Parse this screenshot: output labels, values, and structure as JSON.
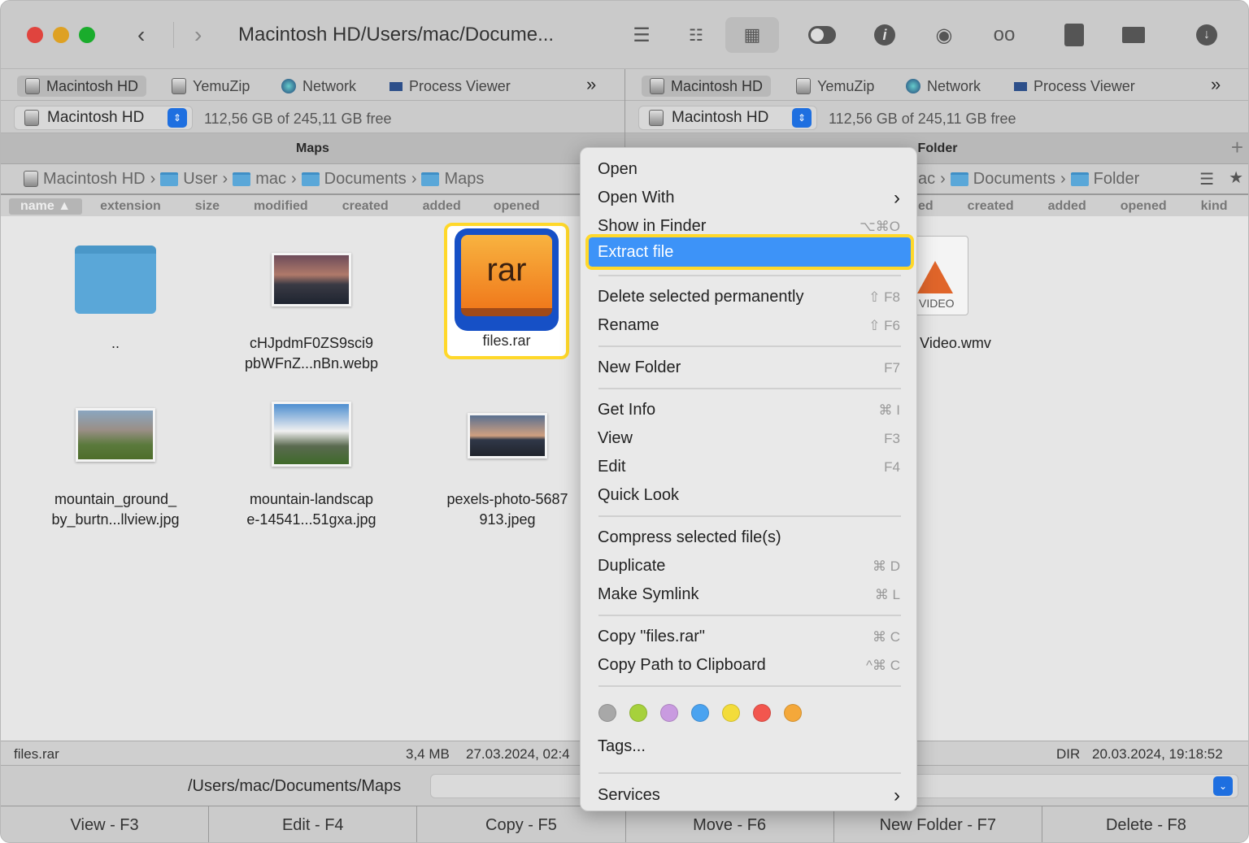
{
  "window": {
    "title": "Macintosh HD/Users/mac/Docume..."
  },
  "toolbar": {
    "icons": [
      "list-icon",
      "detail-list-icon",
      "grid-icon",
      "toggle-icon",
      "info-icon",
      "eye-icon",
      "binoculars-icon",
      "archive-icon",
      "network-drive-icon",
      "download-icon"
    ]
  },
  "bookmarks": [
    "Macintosh HD",
    "YemuZip",
    "Network",
    "Process Viewer"
  ],
  "more": "»",
  "drive": {
    "name": "Macintosh HD",
    "free": "112,56 GB of 245,11 GB free"
  },
  "left": {
    "header": "Maps",
    "crumbs": [
      "Macintosh HD",
      "User",
      "mac",
      "Documents",
      "Maps"
    ],
    "columns": [
      "name ▲",
      "extension",
      "size",
      "modified",
      "created",
      "added",
      "opened"
    ],
    "files": [
      {
        "name": "..",
        "kind": "folder"
      },
      {
        "name1": "cHJpdmF0ZS9sci9",
        "name2": "pbWFnZ...nBn.webp"
      },
      {
        "name": "files.rar",
        "icon_text": "rar"
      },
      {
        "name1": "mountain_ground_",
        "name2": "by_burtn...llview.jpg"
      },
      {
        "name1": "mountain-landscap",
        "name2": "e-14541...51gxa.jpg"
      },
      {
        "name1": "pexels-photo-5687",
        "name2": "913.jpeg"
      }
    ],
    "status": {
      "name": "files.rar",
      "size": "3,4 MB",
      "date": "27.03.2024, 02:4"
    },
    "path": "/Users/mac/Documents/Maps"
  },
  "right": {
    "header": "Folder",
    "crumbs": [
      "ac",
      "Documents",
      "Folder"
    ],
    "columns": [
      "ed",
      "created",
      "added",
      "opened",
      "kind"
    ],
    "files": [
      {
        "name": "Video.wmv",
        "badge": "VIDEO"
      }
    ],
    "status": {
      "kind": "DIR",
      "date": "20.03.2024, 19:18:52"
    }
  },
  "menu": {
    "items": [
      {
        "label": "Open",
        "shortcut": ""
      },
      {
        "label": "Open With",
        "shortcut": "›"
      },
      {
        "label": "Show in Finder",
        "shortcut": "⌥⌘O"
      },
      {
        "label": "Extract file",
        "shortcut": "",
        "highlighted": true
      },
      {
        "label": "Delete selected permanently",
        "shortcut": "⇧ F8"
      },
      {
        "label": "Rename",
        "shortcut": "⇧ F6"
      },
      {
        "label": "New Folder",
        "shortcut": "F7"
      },
      {
        "label": "Get Info",
        "shortcut": "⌘ I"
      },
      {
        "label": "View",
        "shortcut": "F3"
      },
      {
        "label": "Edit",
        "shortcut": "F4"
      },
      {
        "label": "Quick Look",
        "shortcut": ""
      },
      {
        "label": "Compress selected file(s)",
        "shortcut": ""
      },
      {
        "label": "Duplicate",
        "shortcut": "⌘ D"
      },
      {
        "label": "Make Symlink",
        "shortcut": "⌘ L"
      },
      {
        "label": "Copy \"files.rar\"",
        "shortcut": "⌘ C"
      },
      {
        "label": "Copy Path to Clipboard",
        "shortcut": "^⌘ C"
      },
      {
        "label": "Tags...",
        "shortcut": ""
      },
      {
        "label": "Services",
        "shortcut": "›"
      }
    ],
    "tag_colors": [
      "#a8a8a8",
      "#a6d13c",
      "#c99be0",
      "#4aa3f0",
      "#f3dc3a",
      "#f2564e",
      "#f4a83a"
    ]
  },
  "fkeys": [
    "View - F3",
    "Edit - F4",
    "Copy - F5",
    "Move - F6",
    "New Folder - F7",
    "Delete - F8"
  ],
  "colors": {
    "accent": "#3d93f8",
    "highlight": "#ffd82a"
  }
}
